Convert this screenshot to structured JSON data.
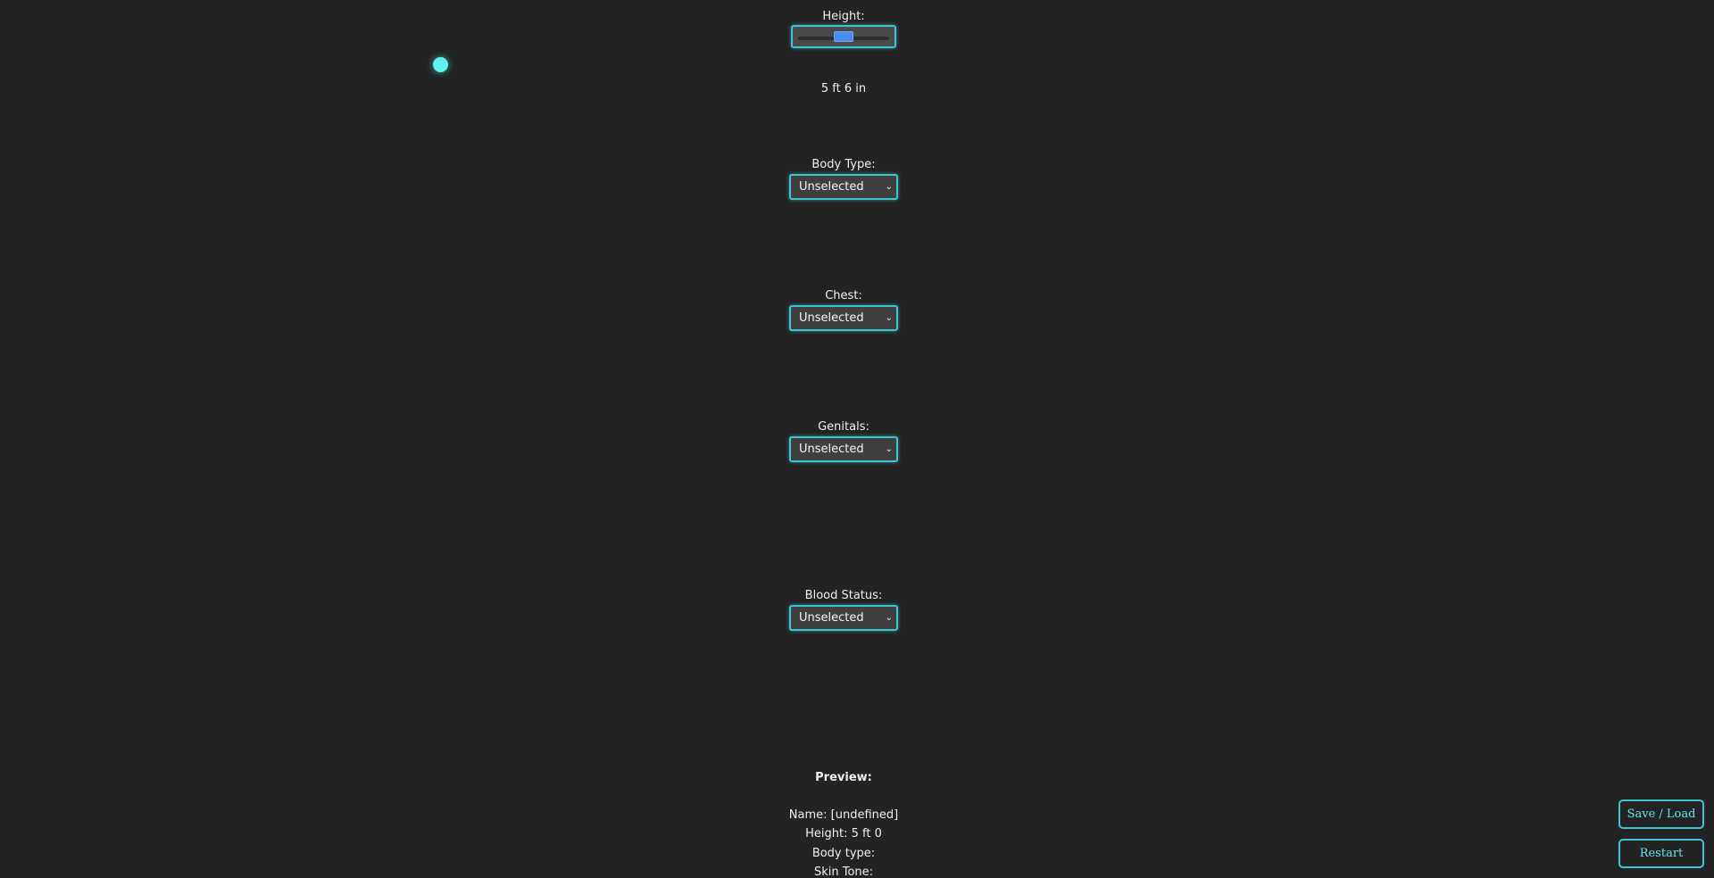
{
  "height": {
    "label": "Height:",
    "slider_value": 0.5,
    "display": "5 ft 6 in"
  },
  "body_type": {
    "label": "Body Type:",
    "selected": "Unselected"
  },
  "chest": {
    "label": "Chest:",
    "selected": "Unselected"
  },
  "genitals": {
    "label": "Genitals:",
    "selected": "Unselected"
  },
  "blood_status": {
    "label": "Blood Status:",
    "selected": "Unselected"
  },
  "preview": {
    "title": "Preview:",
    "name": "Name: [undefined]",
    "height": "Height: 5 ft 0",
    "body_type": "Body type:",
    "skin_tone": "Skin Tone:"
  },
  "buttons": {
    "save_load": "Save / Load",
    "restart": "Restart"
  },
  "colors": {
    "background": "#232323",
    "accent": "#3ec7d3",
    "slider_thumb": "#4a8cf0",
    "dot": "#5ef2f2"
  },
  "icons": {
    "select_chevron": "chevron-down-icon"
  }
}
